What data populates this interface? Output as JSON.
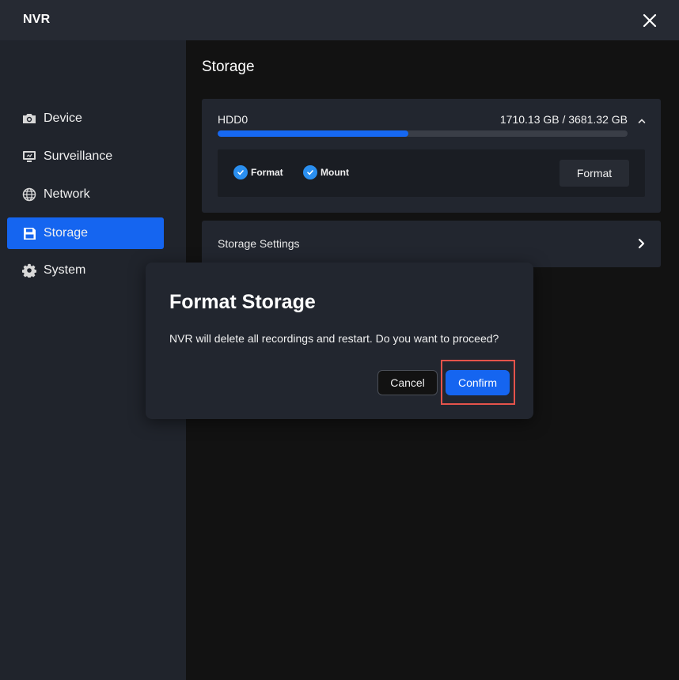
{
  "app": {
    "title": "NVR"
  },
  "sidebar": {
    "items": [
      {
        "label": "Device",
        "icon": "camera-icon",
        "active": false
      },
      {
        "label": "Surveillance",
        "icon": "monitor-icon",
        "active": false
      },
      {
        "label": "Network",
        "icon": "globe-icon",
        "active": false
      },
      {
        "label": "Storage",
        "icon": "floppy-disk-icon",
        "active": true
      },
      {
        "label": "System",
        "icon": "gear-icon",
        "active": false
      }
    ]
  },
  "main": {
    "title": "Storage",
    "hdd": {
      "name": "HDD0",
      "usage_text": "1710.13 GB / 3681.32 GB",
      "used_fraction": 0.4645,
      "checks": [
        {
          "label": "Format",
          "checked": true
        },
        {
          "label": "Mount",
          "checked": true
        }
      ],
      "format_button": "Format"
    },
    "settings_row": {
      "label": "Storage Settings"
    }
  },
  "dialog": {
    "title": "Format Storage",
    "message": "NVR will delete all recordings and restart. Do you want to proceed?",
    "cancel_label": "Cancel",
    "confirm_label": "Confirm"
  },
  "colors": {
    "accent": "#1565f0",
    "highlight": "#e5534b",
    "check": "#2a8ff0"
  }
}
